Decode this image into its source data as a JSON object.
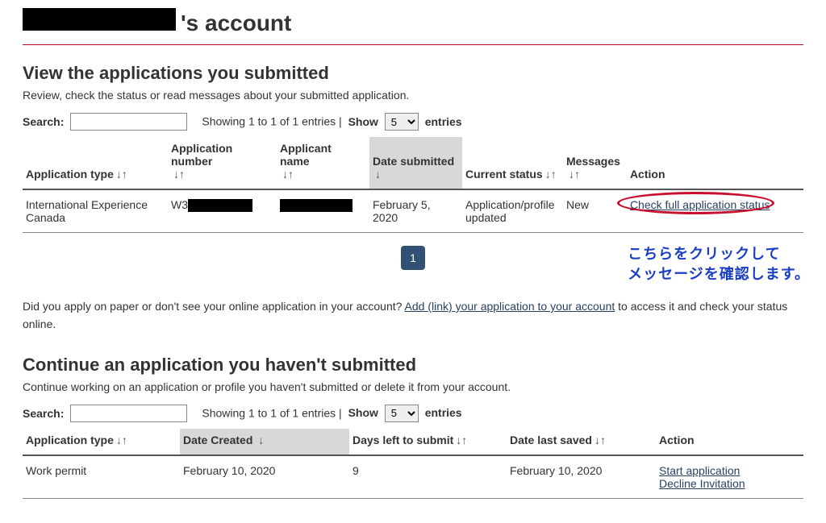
{
  "header": {
    "title_suffix": "'s account"
  },
  "section1": {
    "heading": "View the applications you submitted",
    "subhead": "Review, check the status or read messages about your submitted application.",
    "search_label": "Search:",
    "entries_prefix": "Showing 1 to 1 of 1 entries ",
    "show_label": "Show",
    "entries_select_value": "5",
    "entries_suffix": "entries",
    "columns": {
      "app_type": "Application type",
      "app_number": "Application number",
      "applicant_name": "Applicant name",
      "date_submitted": "Date submitted",
      "current_status": "Current status",
      "messages": "Messages",
      "action": "Action"
    },
    "row": {
      "app_type": "International Experience Canada",
      "app_number_prefix": "W3",
      "date_submitted": "February 5, 2020",
      "current_status": "Application/profile updated",
      "messages": "New",
      "action_link": "Check full application status"
    },
    "page_number": "1",
    "annotation_line1": "こちらをクリックして",
    "annotation_line2": "メッセージを確認します。",
    "lower_note_prefix": "Did you apply on paper or don't see your online application in your account?  ",
    "lower_note_link": "Add (link) your application to your account",
    "lower_note_suffix": " to access it and check your status online."
  },
  "section2": {
    "heading": "Continue an application you haven't submitted",
    "subhead": "Continue working on an application or profile you haven't submitted or delete it from your account.",
    "search_label": "Search:",
    "entries_prefix": "Showing 1 to 1 of 1 entries ",
    "show_label": "Show",
    "entries_select_value": "5",
    "entries_suffix": "entries",
    "columns": {
      "app_type": "Application type",
      "date_created": "Date Created",
      "days_left": "Days left to submit",
      "date_last_saved": "Date last saved",
      "action": "Action"
    },
    "row": {
      "app_type": "Work permit",
      "date_created": "February 10, 2020",
      "days_left": "9",
      "date_last_saved": "February 10, 2020",
      "action_link1": "Start application",
      "action_link2": "Decline Invitation"
    }
  }
}
